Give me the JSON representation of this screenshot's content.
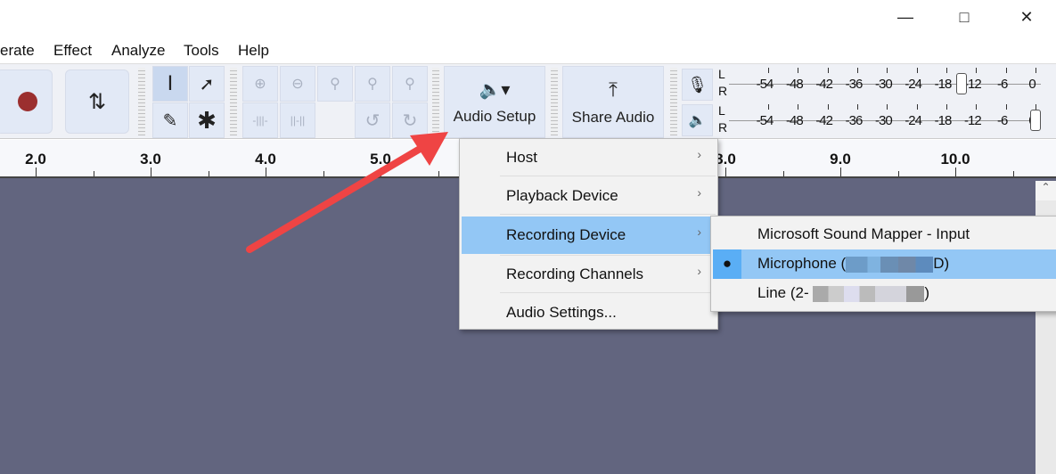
{
  "window": {
    "controls": [
      "minimize-icon",
      "maximize-icon",
      "close-icon"
    ]
  },
  "menubar": [
    "erate",
    "Effect",
    "Analyze",
    "Tools",
    "Help"
  ],
  "toolbar": {
    "audio_setup_label": "Audio Setup",
    "share_audio_label": "Share Audio",
    "record_color": "#9b2f2f"
  },
  "meters": {
    "channels": [
      "L",
      "R"
    ],
    "scale": [
      "-54",
      "-48",
      "-42",
      "-36",
      "-30",
      "-24",
      "-18",
      "-12",
      "-6",
      "0"
    ],
    "record_slider_db": -15,
    "playback_slider_db": 0
  },
  "ruler": {
    "labels": [
      "2.0",
      "3.0",
      "4.0",
      "5.0",
      "8.0",
      "9.0",
      "10.0"
    ]
  },
  "audio_setup_menu": {
    "items": [
      {
        "label": "Host",
        "submenu": true
      },
      {
        "label": "Playback Device",
        "submenu": true
      },
      {
        "label": "Recording Device",
        "submenu": true,
        "highlighted": true
      },
      {
        "label": "Recording Channels",
        "submenu": true
      },
      {
        "label": "Audio Settings...",
        "submenu": false
      }
    ]
  },
  "recording_device_submenu": {
    "items": [
      {
        "label": "Microsoft Sound Mapper - Input"
      },
      {
        "label": "Microphone (",
        "suffix": "D)",
        "selected": true
      },
      {
        "label": "Line (2-",
        "suffix": ")"
      }
    ]
  },
  "colors": {
    "track_bg": "#62657f",
    "highlight": "#93c7f5",
    "arrow": "#ef4444"
  }
}
